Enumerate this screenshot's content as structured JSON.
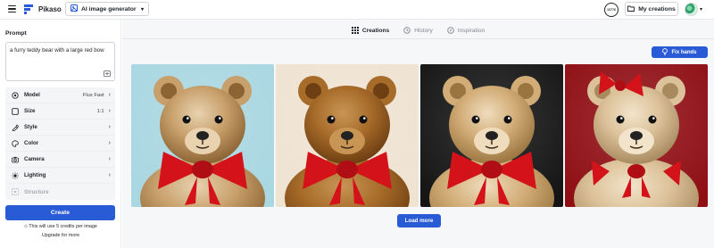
{
  "header": {
    "brand": "Pikaso",
    "tool_select": {
      "label": "AI image generator",
      "icon": "image-generator-icon"
    },
    "credits_badge": "10776",
    "my_creations": "My creations"
  },
  "sidebar": {
    "prompt_label": "Prompt",
    "prompt_value": "a furry teddy bear with a large red bow",
    "settings": [
      {
        "label": "Model",
        "value": "Flux Fast",
        "icon": "model-icon"
      },
      {
        "label": "Size",
        "value": "1:1",
        "icon": "size-icon"
      },
      {
        "label": "Style",
        "value": "",
        "icon": "style-icon"
      },
      {
        "label": "Color",
        "value": "",
        "icon": "color-icon"
      },
      {
        "label": "Camera",
        "value": "",
        "icon": "camera-icon"
      },
      {
        "label": "Lighting",
        "value": "",
        "icon": "lighting-icon"
      },
      {
        "label": "Structure",
        "value": "",
        "icon": "structure-icon",
        "disabled": true
      }
    ],
    "create_label": "Create",
    "credits_note": "This will use 5 credits per image",
    "upgrade_label": "Upgrade for more"
  },
  "main": {
    "tabs": [
      {
        "label": "Creations",
        "icon": "grid-icon",
        "active": true
      },
      {
        "label": "History",
        "icon": "history-icon",
        "active": false
      },
      {
        "label": "Inspiration",
        "icon": "inspiration-icon",
        "active": false
      }
    ],
    "fix_hands_label": "Fix hands",
    "load_more_label": "Load more",
    "images": [
      {
        "subject": "teddy bear with red bow",
        "background": "#a9d7e2"
      },
      {
        "subject": "teddy bear with red bow",
        "background": "#efe3d2"
      },
      {
        "subject": "teddy bear with red bow",
        "background": "#151515"
      },
      {
        "subject": "teddy bear with red bow",
        "background": "#8f0f14"
      }
    ]
  },
  "colors": {
    "accent": "#2a5bd7",
    "bow": "#d3121a",
    "fur": "#c99a5a"
  }
}
